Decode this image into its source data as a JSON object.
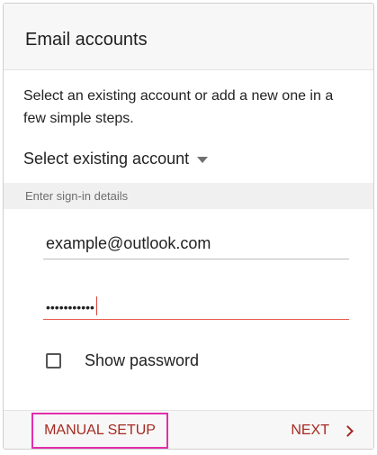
{
  "header": {
    "title": "Email accounts"
  },
  "description": "Select an existing account or add a new one in a few simple steps.",
  "select_existing": {
    "label": "Select existing account"
  },
  "section": {
    "label": "Enter sign-in details"
  },
  "email_field": {
    "value": "example@outlook.com"
  },
  "password_field": {
    "value": "•••••••••••"
  },
  "show_password": {
    "label": "Show password",
    "checked": false
  },
  "footer": {
    "manual_setup_label": "MANUAL SETUP",
    "next_label": "NEXT"
  },
  "colors": {
    "accent_text": "#a62a22",
    "highlight_border": "#e22fa9",
    "focus_underline": "#e85a4f"
  }
}
